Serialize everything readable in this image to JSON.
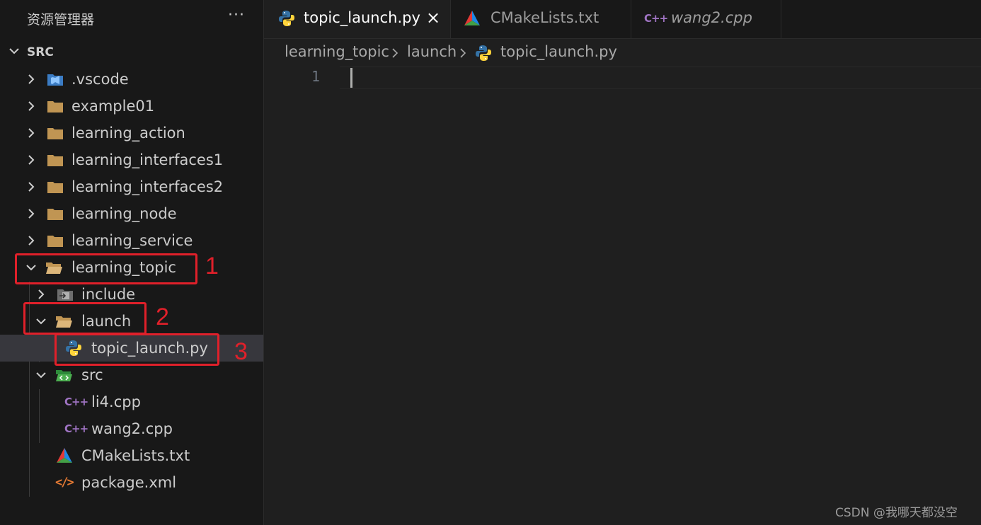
{
  "explorer": {
    "title": "资源管理器",
    "more_icon": "ellipsis-icon",
    "root_label": "SRC",
    "items": [
      {
        "label": ".vscode",
        "icon": "vscode-folder-icon",
        "expanded": false
      },
      {
        "label": "example01",
        "icon": "folder-icon",
        "expanded": false
      },
      {
        "label": "learning_action",
        "icon": "folder-icon",
        "expanded": false
      },
      {
        "label": "learning_interfaces1",
        "icon": "folder-icon",
        "expanded": false
      },
      {
        "label": "learning_interfaces2",
        "icon": "folder-icon",
        "expanded": false
      },
      {
        "label": "learning_node",
        "icon": "folder-icon",
        "expanded": false
      },
      {
        "label": "learning_service",
        "icon": "folder-icon",
        "expanded": false
      },
      {
        "label": "learning_topic",
        "icon": "folder-open-icon",
        "expanded": true
      },
      {
        "label": "include",
        "icon": "include-folder-icon",
        "expanded": false
      },
      {
        "label": "launch",
        "icon": "folder-open-icon",
        "expanded": true
      },
      {
        "label": "topic_launch.py",
        "icon": "python-icon",
        "selected": true
      },
      {
        "label": "src",
        "icon": "src-folder-icon",
        "expanded": true
      },
      {
        "label": "li4.cpp",
        "icon": "cpp-icon"
      },
      {
        "label": "wang2.cpp",
        "icon": "cpp-icon"
      },
      {
        "label": "CMakeLists.txt",
        "icon": "cmake-icon"
      },
      {
        "label": "package.xml",
        "icon": "xml-icon"
      }
    ],
    "cpp_glyph": "C++",
    "xml_glyph": "</>"
  },
  "annotations": [
    "1",
    "2",
    "3"
  ],
  "annotation_color": "#e0202a",
  "tabs": [
    {
      "label": "topic_launch.py",
      "icon": "python-icon",
      "active": true
    },
    {
      "label": "CMakeLists.txt",
      "icon": "cmake-icon",
      "active": false
    },
    {
      "label": "wang2.cpp",
      "icon": "cpp-icon",
      "active": false,
      "preview": true
    }
  ],
  "close_glyph": "×",
  "breadcrumb": [
    "learning_topic",
    "launch",
    "topic_launch.py"
  ],
  "editor": {
    "line_numbers": [
      "1"
    ]
  },
  "watermark": "CSDN @我哪天都没空",
  "colors": {
    "sidebar_bg": "#181818",
    "editor_bg": "#1f1f1f",
    "selection_bg": "#37373d",
    "folder": "#c09553",
    "python_blue": "#3572a5",
    "python_yellow": "#ffd43b"
  }
}
